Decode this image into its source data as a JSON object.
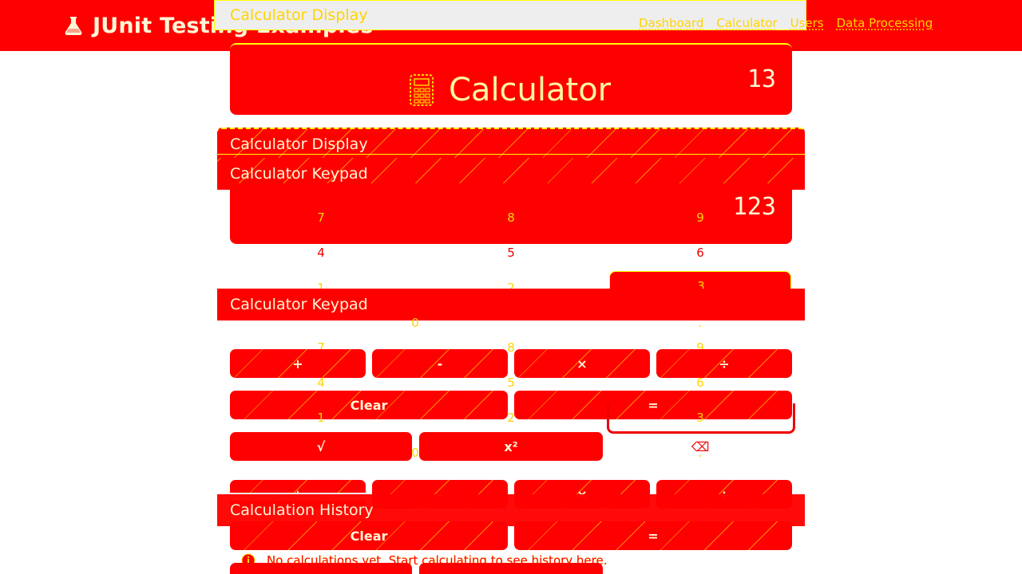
{
  "nav": {
    "brand": "JUnit Testing Examples",
    "links": [
      "Dashboard",
      "Calculator",
      "Users",
      "Data Processing"
    ]
  },
  "ghost": {
    "display_title": "Calculator Display"
  },
  "hero": {
    "title": "Calculator",
    "value": "13"
  },
  "display": {
    "header": "Calculator Display",
    "value": "123"
  },
  "keypad": {
    "header": "Calculator Keypad",
    "row1": [
      "7",
      "8",
      "9"
    ],
    "row2": [
      "4",
      "5",
      "6"
    ],
    "row3": [
      "1",
      "2",
      "3"
    ],
    "row4": [
      "0",
      "."
    ],
    "ops": [
      "+",
      "-",
      "×",
      "÷"
    ],
    "clear": "Clear",
    "equals": "=",
    "sqrt": "√",
    "square": "x²",
    "backspace": "⌫"
  },
  "history": {
    "header": "Calculation History",
    "empty": "No calculations yet. Start calculating to see history here."
  },
  "colors": {
    "primary": "#ff0000",
    "accent": "#ffff00",
    "text": "#fff7d6"
  }
}
